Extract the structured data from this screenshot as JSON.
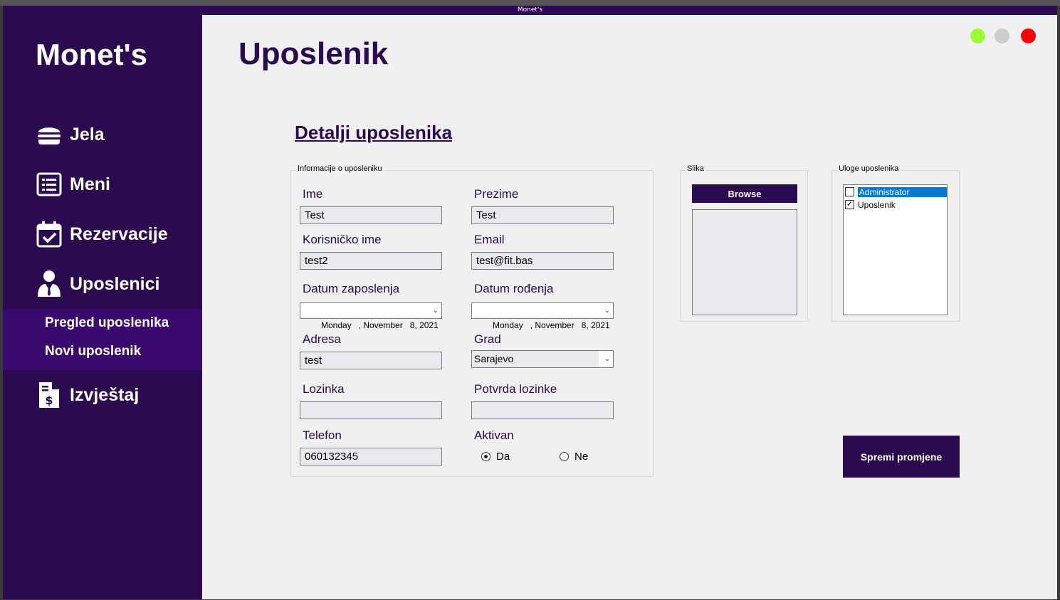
{
  "window": {
    "title": "Monet's"
  },
  "sidebar": {
    "brand": "Monet's",
    "items": [
      {
        "label": "Jela",
        "icon": "burger-icon"
      },
      {
        "label": "Meni",
        "icon": "list-icon"
      },
      {
        "label": "Rezervacije",
        "icon": "calendar-check-icon"
      },
      {
        "label": "Uposlenici",
        "icon": "employee-icon"
      },
      {
        "label": "Izvještaj",
        "icon": "invoice-icon"
      }
    ],
    "sub_items": [
      {
        "label": "Pregled uposlenika"
      },
      {
        "label": "Novi uposlenik"
      }
    ]
  },
  "window_controls": {
    "colors": {
      "minimize": "#99ff33",
      "maximize": "#cccccc",
      "close": "#ff0000"
    }
  },
  "page": {
    "title": "Uposlenik",
    "section_title": "Detalji uposlenika"
  },
  "info_group": {
    "legend": "Informacije o uposleniku",
    "fields": {
      "ime": {
        "label": "Ime",
        "value": "Test"
      },
      "prezime": {
        "label": "Prezime",
        "value": "Test"
      },
      "korisnicko_ime": {
        "label": "Korisničko ime",
        "value": "test2"
      },
      "email": {
        "label": "Email",
        "value": "test@fit.bas"
      },
      "datum_zaposlenja": {
        "label": "Datum zaposlenja",
        "value": "Monday   , November   8, 2021"
      },
      "datum_rodjenja": {
        "label": "Datum rođenja",
        "value": "Monday   , November   8, 2021"
      },
      "adresa": {
        "label": "Adresa",
        "value": "test"
      },
      "grad": {
        "label": "Grad",
        "value": "Sarajevo"
      },
      "lozinka": {
        "label": "Lozinka",
        "value": ""
      },
      "potvrda_lozinke": {
        "label": "Potvrda lozinke",
        "value": ""
      },
      "telefon": {
        "label": "Telefon",
        "value": "060132345"
      },
      "aktivan": {
        "label": "Aktivan",
        "options": [
          "Da",
          "Ne"
        ],
        "selected": "Da"
      }
    }
  },
  "slika_group": {
    "legend": "Slika",
    "browse_label": "Browse"
  },
  "uloge_group": {
    "legend": "Uloge uposlenika",
    "roles": [
      {
        "label": "Administrator",
        "checked": false,
        "selected": true
      },
      {
        "label": "Uposlenik",
        "checked": true,
        "selected": false
      }
    ]
  },
  "save_button": {
    "label": "Spremi promjene"
  },
  "colors": {
    "brand_dark": "#2c0a4f",
    "sub_panel": "#3b0a6e",
    "selection": "#0078d7"
  }
}
